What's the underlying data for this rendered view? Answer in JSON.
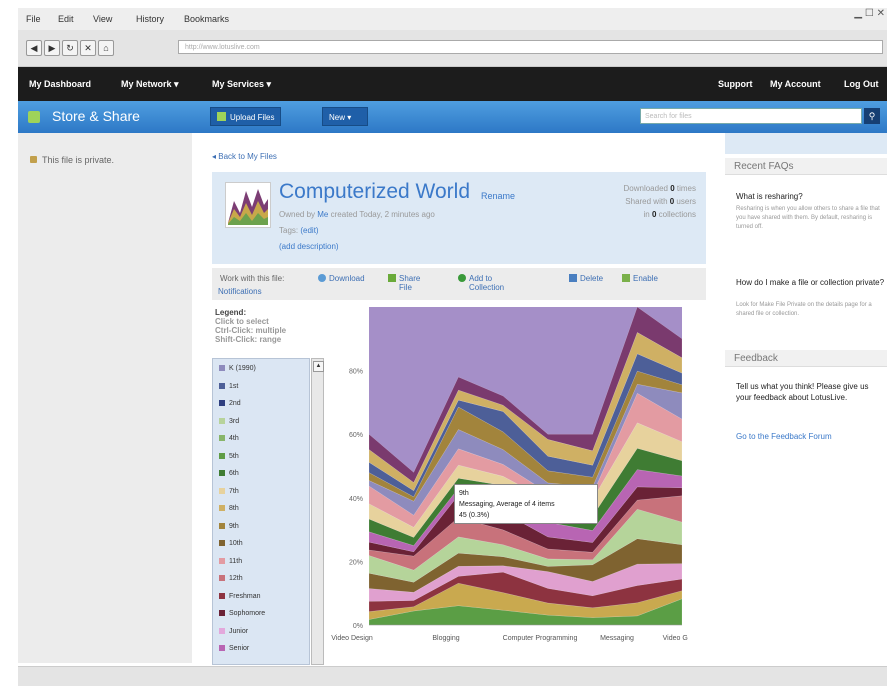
{
  "browser": {
    "menu": [
      "File",
      "Edit",
      "View",
      "History",
      "Bookmarks"
    ],
    "url": "http://www.lotuslive.com"
  },
  "topnav": {
    "left": [
      "My Dashboard",
      "My Network ▾",
      "My Services ▾"
    ],
    "right": [
      "Support",
      "My Account",
      "Log Out"
    ]
  },
  "appbar": {
    "title": "Store & Share",
    "upload_label": "Upload Files",
    "new_label": "New ▾",
    "search_placeholder": "Search for files"
  },
  "sidebar": {
    "private_note": "This file is private."
  },
  "main": {
    "back_link": "◂ Back to My Files",
    "title": "Computerized World",
    "rename": "Rename",
    "owner_prefix": "Owned by",
    "owner_name": "Me",
    "owner_suffix": "created Today, 2 minutes ago",
    "tags_label": "Tags:",
    "tags_value": "(edit)",
    "add_description": "(add description)",
    "stats": [
      {
        "prefix": "Downloaded ",
        "value": "0",
        "suffix": " times"
      },
      {
        "prefix": "Shared with ",
        "value": "0",
        "suffix": " users"
      },
      {
        "prefix": "in ",
        "value": "0",
        "suffix": " collections"
      }
    ],
    "actions": {
      "lead": "Work with this file:",
      "download": "Download",
      "share": "Share File",
      "add_collection": "Add to Collection",
      "delete": "Delete",
      "enable": "Enable",
      "notifications": "Notifications"
    },
    "legend": {
      "title": "Legend:",
      "help": [
        "Click to select",
        "Ctrl-Click: multiple",
        "Shift-Click: range"
      ]
    },
    "tooltip": [
      "9th",
      "Messaging, Average of 4 items",
      "45 (0.3%)"
    ]
  },
  "right": {
    "faq_title": "Recent FAQs",
    "faqs": [
      {
        "q": "What is resharing?",
        "a": "Resharing is when you allow others to share a file that you have shared with them. By default, resharing is turned off."
      },
      {
        "q": "How do I make a file or collection private?",
        "a": "Look for Make File Private on the details page for a shared file or collection."
      }
    ],
    "feedback_title": "Feedback",
    "feedback_text": "Tell us what you think! Please give us your feedback about LotusLive.",
    "feedback_link": "Go to the Feedback Forum"
  },
  "chart_data": {
    "type": "area",
    "categories": [
      "Video Design",
      "Blogging",
      "Computer Programming",
      "Messaging",
      "Video Game"
    ],
    "y_ticks": [
      "0%",
      "20%",
      "40%",
      "60%",
      "80%"
    ],
    "ylim": [
      0,
      100
    ],
    "tooltip_text": "9th, Messaging, Average of 4 items, 45 (0.3%)",
    "series": [
      {
        "name": "K (1990)",
        "color": "#8e8bbd"
      },
      {
        "name": "1st",
        "color": "#4d5f98"
      },
      {
        "name": "2nd",
        "color": "#2f3f80"
      },
      {
        "name": "3rd",
        "color": "#b7d39b"
      },
      {
        "name": "4th",
        "color": "#88b56a"
      },
      {
        "name": "5th",
        "color": "#5f9c45"
      },
      {
        "name": "6th",
        "color": "#3f7c33"
      },
      {
        "name": "7th",
        "color": "#e7d29d"
      },
      {
        "name": "8th",
        "color": "#cfb064"
      },
      {
        "name": "9th",
        "color": "#a2843c"
      },
      {
        "name": "10th",
        "color": "#7f6330"
      },
      {
        "name": "11th",
        "color": "#e39ba2"
      },
      {
        "name": "12th",
        "color": "#c8727b"
      },
      {
        "name": "Freshman",
        "color": "#8d3340"
      },
      {
        "name": "Sophomore",
        "color": "#6a2236"
      },
      {
        "name": "Junior",
        "color": "#e3a8dc"
      },
      {
        "name": "Senior",
        "color": "#b865b3"
      }
    ],
    "stack_totals": [
      60,
      48,
      78,
      72,
      60,
      60,
      100,
      90
    ]
  }
}
